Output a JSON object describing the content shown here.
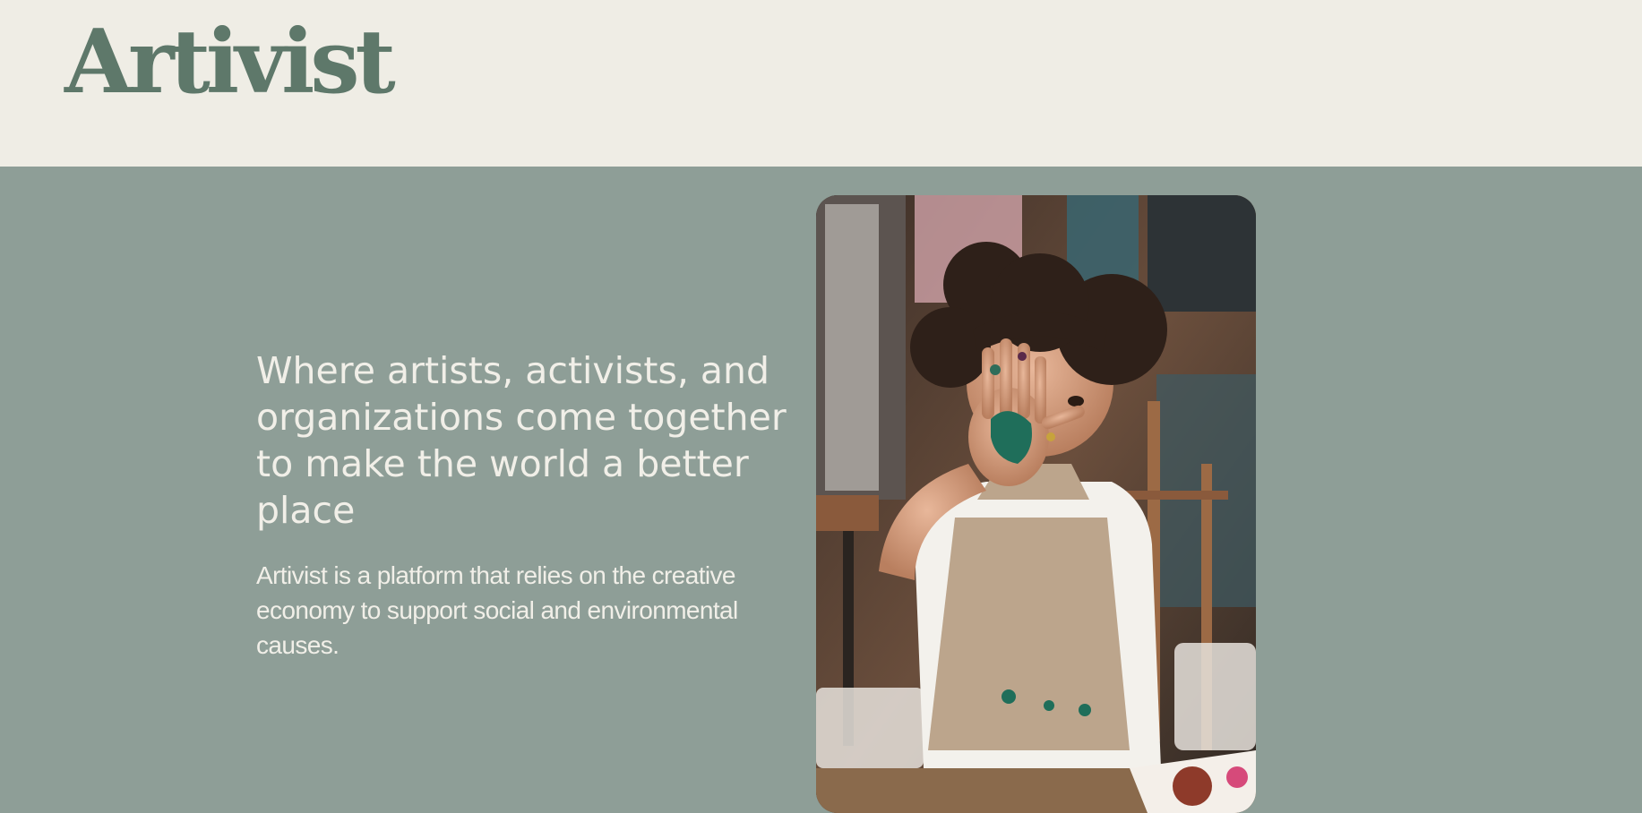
{
  "header": {
    "logo_text": "Artivist"
  },
  "hero": {
    "headline": "Where artists, activists, and organizations come together to make the world a better place",
    "description": "Artivist is a platform that relies on the creative economy to support social and environmental causes.",
    "image_icon": "child-painted-hand-photo"
  },
  "colors": {
    "header_background": "#efede5",
    "hero_background": "#8e9e97",
    "logo": "#5e786a",
    "hero_text": "#f1efe8"
  }
}
